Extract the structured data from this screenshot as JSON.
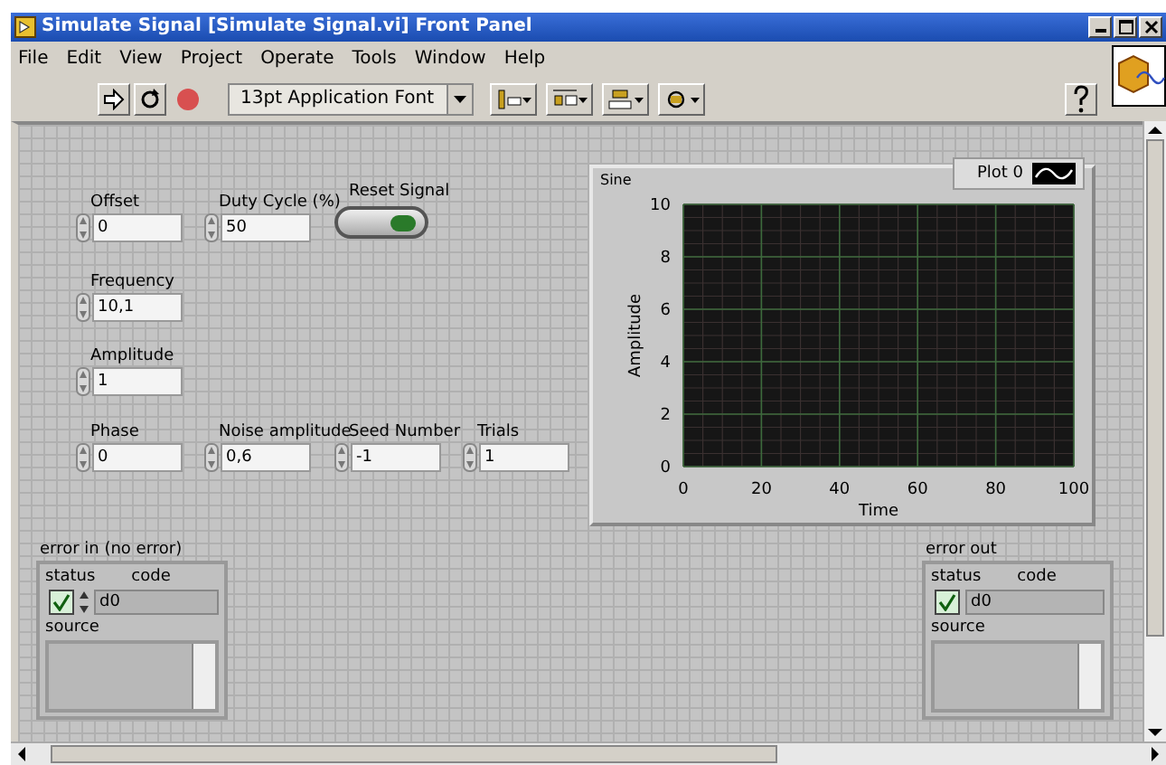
{
  "window": {
    "title": "Simulate Signal [Simulate Signal.vi] Front Panel"
  },
  "menu": [
    "File",
    "Edit",
    "View",
    "Project",
    "Operate",
    "Tools",
    "Window",
    "Help"
  ],
  "toolbar": {
    "font": "13pt Application Font"
  },
  "controls": [
    {
      "label": "Offset",
      "value": "0"
    },
    {
      "label": "Duty Cycle (%)",
      "value": "50"
    },
    {
      "label": "Frequency",
      "value": "10,1"
    },
    {
      "label": "Amplitude",
      "value": "1"
    },
    {
      "label": "Phase",
      "value": "0"
    },
    {
      "label": "Noise amplitude",
      "value": "0,6"
    },
    {
      "label": "Seed Number",
      "value": "-1"
    },
    {
      "label": "Trials",
      "value": "1"
    }
  ],
  "reset_button": {
    "label": "Reset Signal",
    "on": true
  },
  "graph": {
    "title": "Sine",
    "legend": "Plot 0",
    "x_axis_title": "Time",
    "y_axis_title": "Amplitude",
    "x_ticks": [
      "0",
      "20",
      "40",
      "60",
      "80",
      "100"
    ],
    "y_ticks": [
      "10",
      "8",
      "6",
      "4",
      "2",
      "0"
    ]
  },
  "clusters": [
    {
      "label": "error in (no error)",
      "status_label": "status",
      "code_label": "code",
      "status": true,
      "code": "d0",
      "source_label": "source",
      "has_spinner": true
    },
    {
      "label": "error out",
      "status_label": "status",
      "code_label": "code",
      "status": true,
      "code": "d0",
      "source_label": "source",
      "has_spinner": false
    }
  ]
}
